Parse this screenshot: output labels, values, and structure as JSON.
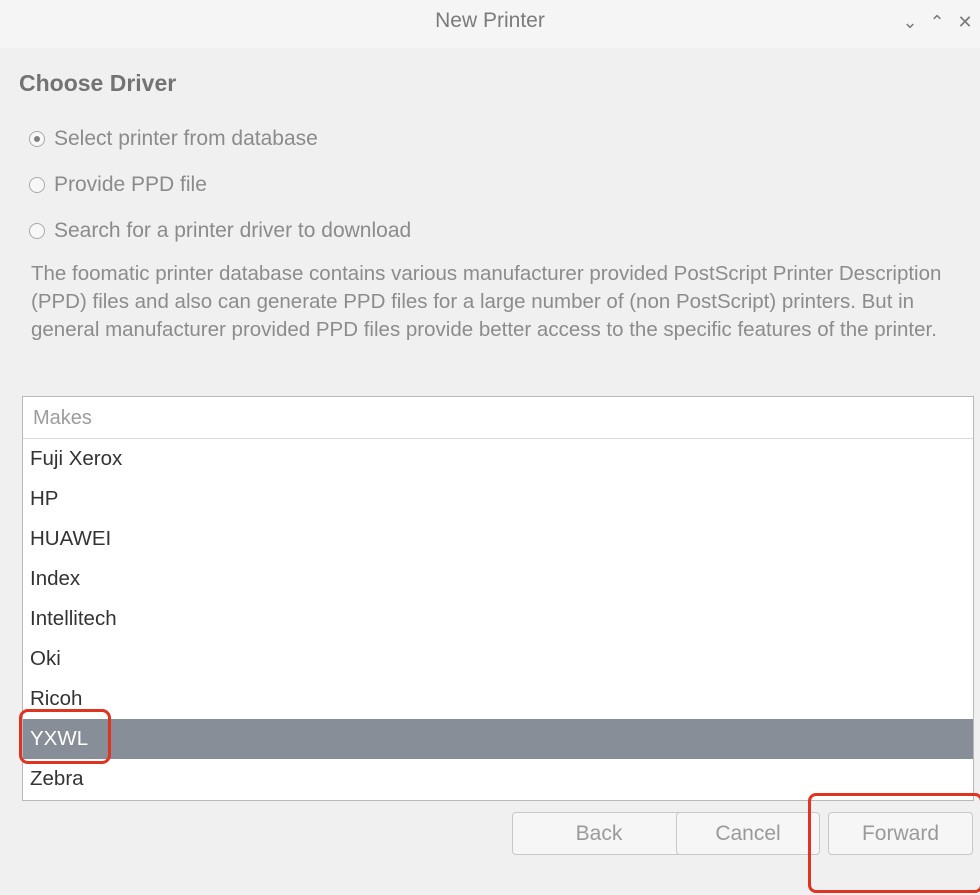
{
  "window": {
    "title": "New Printer",
    "controls": {
      "minimize": "⌄",
      "maximize": "⌃",
      "close": "✕"
    }
  },
  "page": {
    "heading": "Choose Driver"
  },
  "options": [
    {
      "label": "Select printer from database",
      "checked": true
    },
    {
      "label": "Provide PPD file",
      "checked": false
    },
    {
      "label": "Search for a printer driver to download",
      "checked": false
    }
  ],
  "description": "The foomatic printer database contains various manufacturer provided PostScript Printer Description (PPD) files and also can generate PPD files for a large number of (non PostScript) printers. But in general manufacturer provided PPD files provide better access to the specific features of the printer.",
  "makes": {
    "header": "Makes",
    "items": [
      "Fuji Xerox",
      "HP",
      "HUAWEI",
      "Index",
      "Intellitech",
      "Oki",
      "Ricoh",
      "YXWL",
      "Zebra"
    ],
    "selected": "YXWL"
  },
  "buttons": {
    "back": "Back",
    "cancel": "Cancel",
    "forward": "Forward"
  },
  "colors": {
    "selection": "#878e97",
    "annotation": "#e03322"
  },
  "icons": {
    "minimize": "chevron-down-icon",
    "maximize": "chevron-up-icon",
    "close": "close-icon"
  }
}
